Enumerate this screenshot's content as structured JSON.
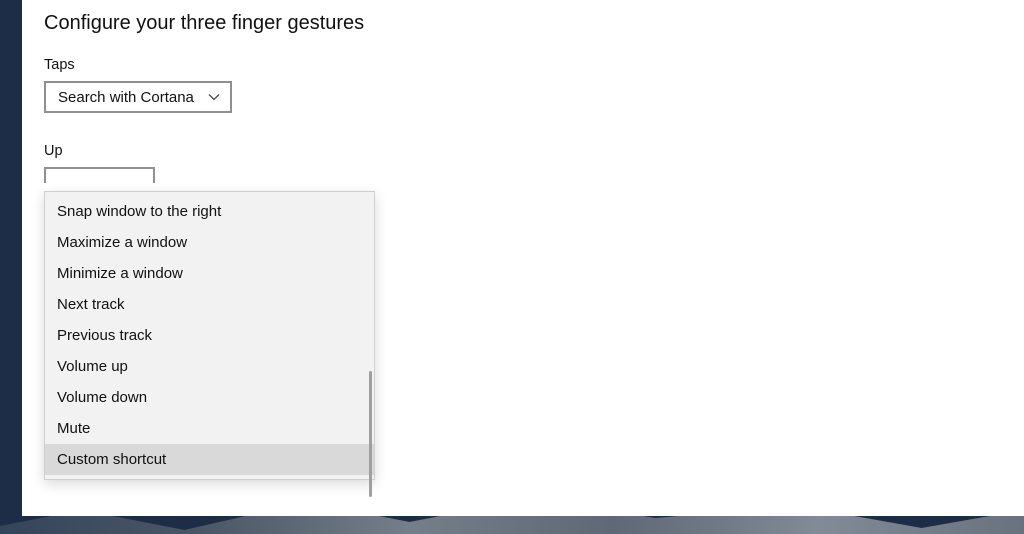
{
  "title": "Configure your three finger gestures",
  "taps": {
    "label": "Taps",
    "selected": "Search with Cortana"
  },
  "up": {
    "label": "Up",
    "dropdown": {
      "items": [
        "Snap window to the right",
        "Maximize a window",
        "Minimize a window",
        "Next track",
        "Previous track",
        "Volume up",
        "Volume down",
        "Mute",
        "Custom shortcut"
      ],
      "highlighted_index": 8
    }
  }
}
